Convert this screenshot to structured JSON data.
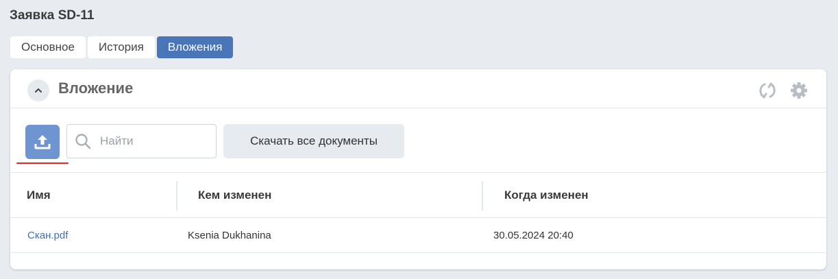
{
  "page": {
    "title": "Заявка SD-11"
  },
  "tabs": [
    {
      "label": "Основное",
      "active": false
    },
    {
      "label": "История",
      "active": false
    },
    {
      "label": "Вложения",
      "active": true
    }
  ],
  "panel": {
    "title": "Вложение",
    "icons": [
      "chevron-up-icon",
      "refresh-icon",
      "gear-icon",
      "upload-icon",
      "search-icon"
    ]
  },
  "toolbar": {
    "search_placeholder": "Найти",
    "search_value": "",
    "download_all_label": "Скачать все документы"
  },
  "table": {
    "columns": [
      "Имя",
      "Кем изменен",
      "Когда изменен"
    ],
    "rows": [
      {
        "name": "Скан.pdf",
        "modified_by": "Ksenia Dukhanina",
        "modified_at": "30.05.2024 20:40"
      }
    ]
  },
  "colors": {
    "accent": "#4a76b9",
    "upload_button": "#6e95cf",
    "highlight_underline": "#e8251f",
    "link": "#3f6fb5"
  }
}
